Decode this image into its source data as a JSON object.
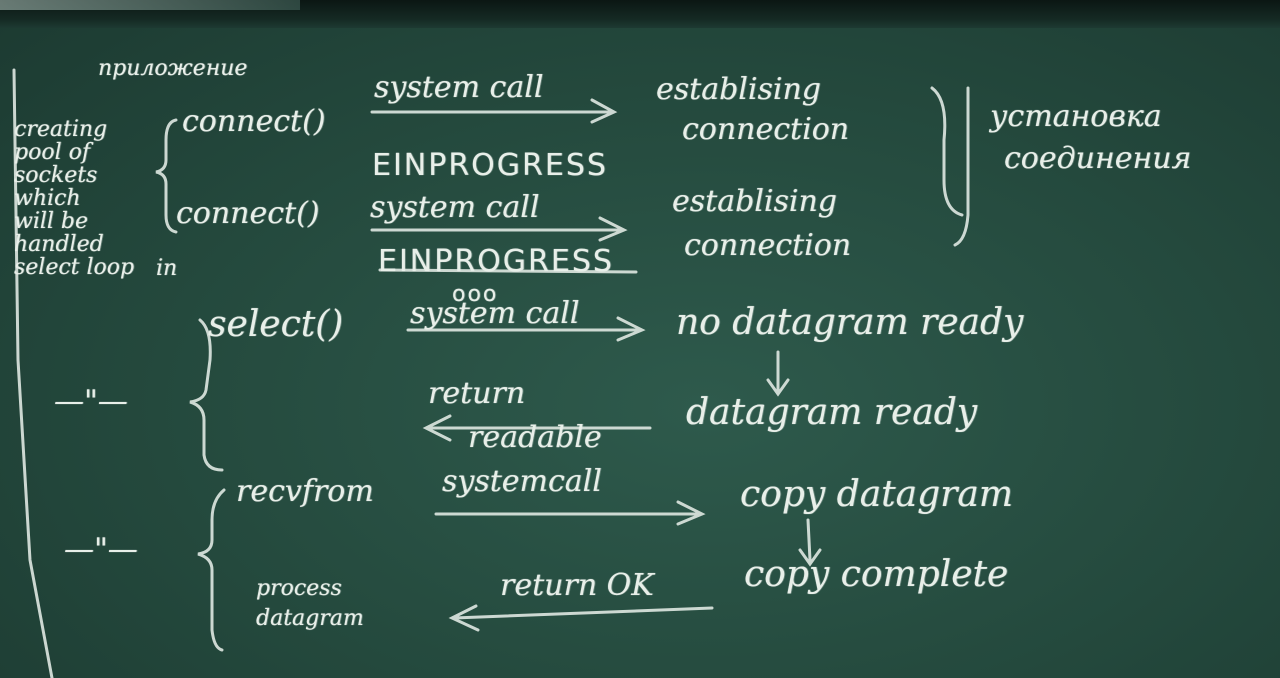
{
  "board": {
    "left_column": {
      "heading": "приложение",
      "note_lines": [
        "creating",
        "pool of",
        "sockets",
        "which",
        "will be",
        "handled",
        "select loop"
      ],
      "note_in": "in"
    },
    "rows": {
      "connect_1": "connect()",
      "system_call_1": "system call",
      "establishing_1": [
        "establising",
        "connection"
      ],
      "einprogress_1": "EINPROGRESS",
      "connect_2": "connect()",
      "system_call_2": "system call",
      "establishing_2": [
        "establising",
        "connection"
      ],
      "einprogress_2": "EINPROGRESS",
      "ellipsis": "ooo",
      "select": "select()",
      "system_call_3": "system call",
      "no_datagram_ready": "no datagram ready",
      "return_readable": [
        "return",
        "readable"
      ],
      "datagram_ready": "datagram ready",
      "ditto_1": "—\"—",
      "recvfrom": "recvfrom",
      "system_call_4": "systemcall",
      "copy_datagram": "copy datagram",
      "ditto_2": "—\"—",
      "process_datagram": [
        "process",
        "datagram"
      ],
      "return_ok": "return OK",
      "copy_complete": "copy complete"
    },
    "right_bracket_note": [
      "установка",
      "соединения"
    ]
  }
}
